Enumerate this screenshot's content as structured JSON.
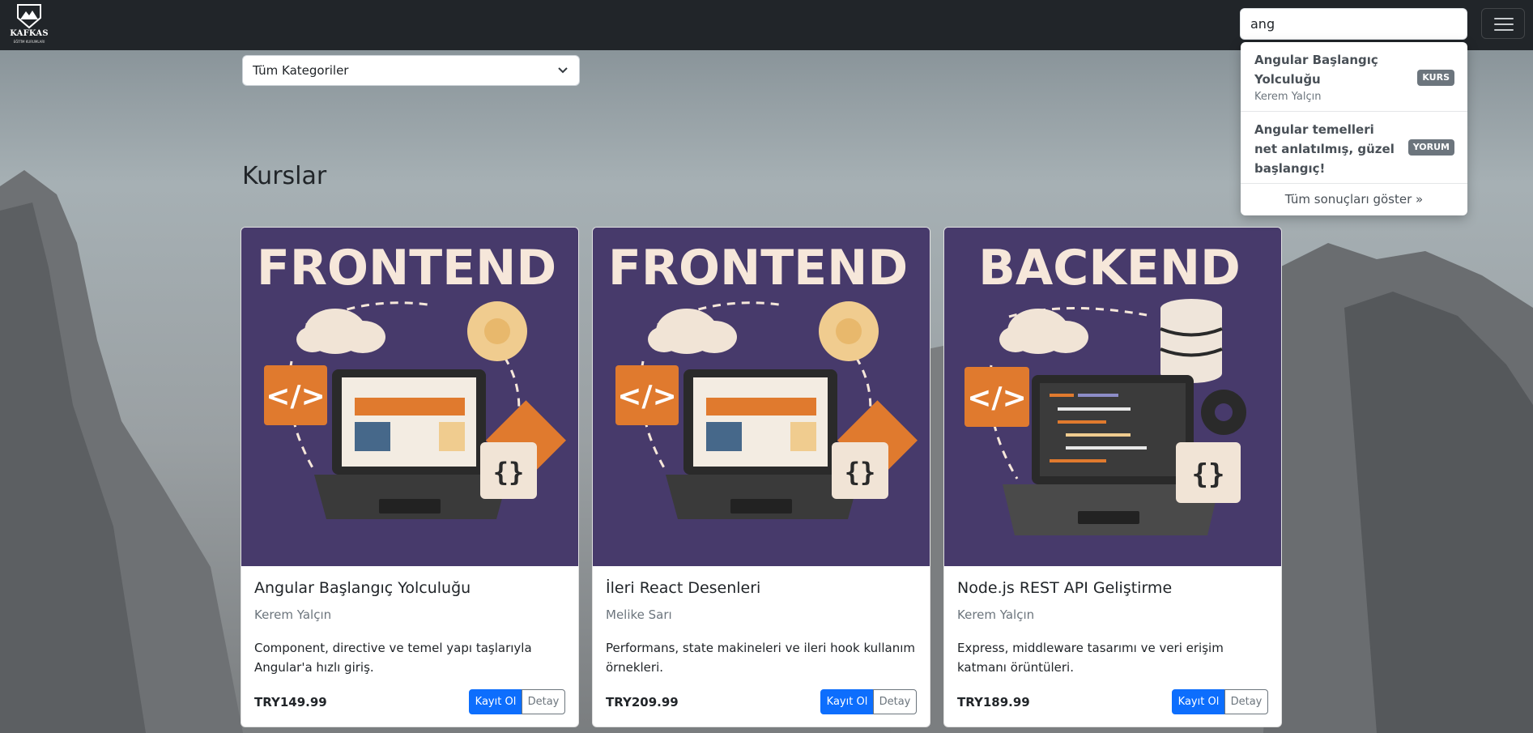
{
  "brand": {
    "name": "KAFKAS",
    "subtitle": "EĞİTİM KURUMLARI"
  },
  "search": {
    "value": "ang",
    "placeholder": ""
  },
  "dropdown": {
    "results": [
      {
        "title": "Angular Başlangıç Yolculuğu",
        "subtitle": "Kerem Yalçın",
        "badge": "KURS"
      },
      {
        "title": "Angular temelleri net anlatılmış, güzel başlangıç!",
        "subtitle": "",
        "badge": "YORUM"
      }
    ],
    "show_all": "Tüm sonuçları göster »"
  },
  "category": {
    "selected": "Tüm Kategoriler"
  },
  "section": {
    "title": "Kurslar"
  },
  "colors": {
    "navbar": "#212529",
    "primary": "#0d6efd",
    "card_banner": "#473a6b",
    "accent_orange": "#e07a2e",
    "badge": "#6c757d"
  },
  "courses": [
    {
      "banner": "FRONTEND",
      "title": "Angular Başlangıç Yolculuğu",
      "author": "Kerem Yalçın",
      "description": "Component, directive ve temel yapı taşlarıyla Angular'a hızlı giriş.",
      "price": "TRY149.99",
      "enroll_label": "Kayıt Ol",
      "detail_label": "Detay"
    },
    {
      "banner": "FRONTEND",
      "title": "İleri React Desenleri",
      "author": "Melike Sarı",
      "description": "Performans, state makineleri ve ileri hook kullanım örnekleri.",
      "price": "TRY209.99",
      "enroll_label": "Kayıt Ol",
      "detail_label": "Detay"
    },
    {
      "banner": "BACKEND",
      "title": "Node.js REST API Geliştirme",
      "author": "Kerem Yalçın",
      "description": "Express, middleware tasarımı ve veri erişim katmanı örüntüleri.",
      "price": "TRY189.99",
      "enroll_label": "Kayıt Ol",
      "detail_label": "Detay"
    }
  ]
}
